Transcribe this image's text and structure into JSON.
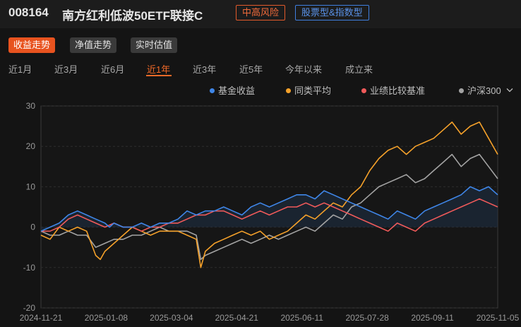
{
  "header": {
    "code": "008164",
    "name": "南方红利低波50ETF联接C",
    "risk": "中高风险",
    "type": "股票型&指数型"
  },
  "subtabs": [
    {
      "label": "收益走势",
      "active": true
    },
    {
      "label": "净值走势",
      "active": false
    },
    {
      "label": "实时估值",
      "active": false
    }
  ],
  "periods": [
    {
      "label": "近1月",
      "active": false
    },
    {
      "label": "近3月",
      "active": false
    },
    {
      "label": "近6月",
      "active": false
    },
    {
      "label": "近1年",
      "active": true
    },
    {
      "label": "近3年",
      "active": false
    },
    {
      "label": "近5年",
      "active": false
    },
    {
      "label": "今年以来",
      "active": false
    },
    {
      "label": "成立来",
      "active": false
    }
  ],
  "legend": [
    {
      "label": "基金收益",
      "color": "#3f86e8"
    },
    {
      "label": "同类平均",
      "color": "#f5a12a"
    },
    {
      "label": "业绩比较基准",
      "color": "#f05a5a"
    },
    {
      "label": "沪深300",
      "color": "#a3a3a3",
      "dropdown_icon": "chevron-down-icon"
    }
  ],
  "chart_data": {
    "type": "line",
    "ylim": [
      -20,
      30
    ],
    "yticks": [
      "30",
      "20",
      "10",
      "0",
      "-10",
      "-20"
    ],
    "xticks": [
      "2024-11-21",
      "2025-01-08",
      "2025-03-04",
      "2025-04-21",
      "2025-06-11",
      "2025-07-28",
      "2025-09-11",
      "2025-11-05"
    ],
    "grid": true,
    "series": [
      {
        "name": "基金收益",
        "color": "#3f86e8",
        "fill": true,
        "points": [
          [
            0,
            -1
          ],
          [
            2,
            0
          ],
          [
            4,
            1
          ],
          [
            6,
            3
          ],
          [
            8,
            4
          ],
          [
            10,
            3
          ],
          [
            12,
            2
          ],
          [
            14,
            1
          ],
          [
            15,
            0
          ],
          [
            16,
            1
          ],
          [
            18,
            0
          ],
          [
            20,
            0
          ],
          [
            22,
            1
          ],
          [
            24,
            0
          ],
          [
            26,
            1
          ],
          [
            28,
            1
          ],
          [
            30,
            2
          ],
          [
            32,
            4
          ],
          [
            34,
            3
          ],
          [
            36,
            4
          ],
          [
            38,
            4
          ],
          [
            40,
            5
          ],
          [
            42,
            4
          ],
          [
            44,
            3
          ],
          [
            46,
            5
          ],
          [
            48,
            6
          ],
          [
            50,
            5
          ],
          [
            52,
            6
          ],
          [
            54,
            7
          ],
          [
            56,
            8
          ],
          [
            58,
            8
          ],
          [
            60,
            7
          ],
          [
            62,
            9
          ],
          [
            64,
            8
          ],
          [
            66,
            7
          ],
          [
            68,
            6
          ],
          [
            70,
            5
          ],
          [
            72,
            4
          ],
          [
            74,
            3
          ],
          [
            76,
            2
          ],
          [
            78,
            4
          ],
          [
            80,
            3
          ],
          [
            82,
            2
          ],
          [
            84,
            4
          ],
          [
            86,
            5
          ],
          [
            88,
            6
          ],
          [
            90,
            7
          ],
          [
            92,
            8
          ],
          [
            94,
            10
          ],
          [
            96,
            9
          ],
          [
            98,
            10
          ],
          [
            100,
            8
          ]
        ]
      },
      {
        "name": "同类平均",
        "color": "#f5a12a",
        "points": [
          [
            0,
            -2
          ],
          [
            2,
            -3
          ],
          [
            4,
            0
          ],
          [
            6,
            -1
          ],
          [
            8,
            0
          ],
          [
            10,
            -1
          ],
          [
            12,
            -7
          ],
          [
            13,
            -8
          ],
          [
            14,
            -6
          ],
          [
            16,
            -4
          ],
          [
            18,
            -2
          ],
          [
            20,
            0
          ],
          [
            22,
            -1
          ],
          [
            24,
            -2
          ],
          [
            26,
            -1
          ],
          [
            28,
            -1
          ],
          [
            30,
            -1
          ],
          [
            32,
            -2
          ],
          [
            34,
            -3
          ],
          [
            35,
            -10
          ],
          [
            36,
            -6
          ],
          [
            38,
            -4
          ],
          [
            40,
            -3
          ],
          [
            42,
            -2
          ],
          [
            44,
            -1
          ],
          [
            46,
            -2
          ],
          [
            48,
            -1
          ],
          [
            50,
            -3
          ],
          [
            52,
            -2
          ],
          [
            54,
            -1
          ],
          [
            56,
            1
          ],
          [
            58,
            3
          ],
          [
            60,
            2
          ],
          [
            62,
            4
          ],
          [
            64,
            6
          ],
          [
            66,
            5
          ],
          [
            68,
            8
          ],
          [
            70,
            10
          ],
          [
            72,
            14
          ],
          [
            74,
            17
          ],
          [
            76,
            19
          ],
          [
            78,
            20
          ],
          [
            80,
            18
          ],
          [
            82,
            20
          ],
          [
            84,
            21
          ],
          [
            86,
            22
          ],
          [
            88,
            24
          ],
          [
            90,
            26
          ],
          [
            92,
            23
          ],
          [
            94,
            25
          ],
          [
            96,
            26
          ],
          [
            98,
            22
          ],
          [
            100,
            18
          ]
        ]
      },
      {
        "name": "业绩比较基准",
        "color": "#f05a5a",
        "points": [
          [
            0,
            -1
          ],
          [
            2,
            -1
          ],
          [
            4,
            0
          ],
          [
            6,
            2
          ],
          [
            8,
            3
          ],
          [
            10,
            2
          ],
          [
            12,
            1
          ],
          [
            14,
            0
          ],
          [
            16,
            1
          ],
          [
            18,
            0
          ],
          [
            20,
            0
          ],
          [
            22,
            -1
          ],
          [
            24,
            0
          ],
          [
            26,
            0
          ],
          [
            28,
            1
          ],
          [
            30,
            1
          ],
          [
            32,
            2
          ],
          [
            34,
            3
          ],
          [
            36,
            3
          ],
          [
            38,
            4
          ],
          [
            40,
            4
          ],
          [
            42,
            3
          ],
          [
            44,
            2
          ],
          [
            46,
            3
          ],
          [
            48,
            4
          ],
          [
            50,
            3
          ],
          [
            52,
            4
          ],
          [
            54,
            5
          ],
          [
            56,
            5
          ],
          [
            58,
            6
          ],
          [
            60,
            5
          ],
          [
            62,
            6
          ],
          [
            64,
            5
          ],
          [
            66,
            4
          ],
          [
            68,
            3
          ],
          [
            70,
            2
          ],
          [
            72,
            1
          ],
          [
            74,
            0
          ],
          [
            76,
            -1
          ],
          [
            78,
            1
          ],
          [
            80,
            0
          ],
          [
            82,
            -1
          ],
          [
            84,
            1
          ],
          [
            86,
            2
          ],
          [
            88,
            3
          ],
          [
            90,
            4
          ],
          [
            92,
            5
          ],
          [
            94,
            6
          ],
          [
            96,
            7
          ],
          [
            98,
            6
          ],
          [
            100,
            5
          ]
        ]
      },
      {
        "name": "沪深300",
        "color": "#a3a3a3",
        "points": [
          [
            0,
            -1
          ],
          [
            2,
            -2
          ],
          [
            4,
            -2
          ],
          [
            6,
            -1
          ],
          [
            8,
            -2
          ],
          [
            10,
            -2
          ],
          [
            12,
            -5
          ],
          [
            14,
            -4
          ],
          [
            16,
            -3
          ],
          [
            18,
            -3
          ],
          [
            20,
            -2
          ],
          [
            22,
            -2
          ],
          [
            24,
            -1
          ],
          [
            26,
            0
          ],
          [
            28,
            -1
          ],
          [
            30,
            -1
          ],
          [
            32,
            -1
          ],
          [
            34,
            -2
          ],
          [
            35,
            -8
          ],
          [
            36,
            -7
          ],
          [
            38,
            -6
          ],
          [
            40,
            -5
          ],
          [
            42,
            -4
          ],
          [
            44,
            -3
          ],
          [
            46,
            -4
          ],
          [
            48,
            -3
          ],
          [
            50,
            -2
          ],
          [
            52,
            -3
          ],
          [
            54,
            -2
          ],
          [
            56,
            -1
          ],
          [
            58,
            0
          ],
          [
            60,
            -1
          ],
          [
            62,
            1
          ],
          [
            64,
            3
          ],
          [
            66,
            2
          ],
          [
            68,
            5
          ],
          [
            70,
            6
          ],
          [
            72,
            8
          ],
          [
            74,
            10
          ],
          [
            76,
            11
          ],
          [
            78,
            12
          ],
          [
            80,
            13
          ],
          [
            82,
            11
          ],
          [
            84,
            12
          ],
          [
            86,
            14
          ],
          [
            88,
            16
          ],
          [
            90,
            18
          ],
          [
            92,
            15
          ],
          [
            94,
            17
          ],
          [
            96,
            18
          ],
          [
            98,
            15
          ],
          [
            100,
            12
          ]
        ]
      }
    ]
  }
}
